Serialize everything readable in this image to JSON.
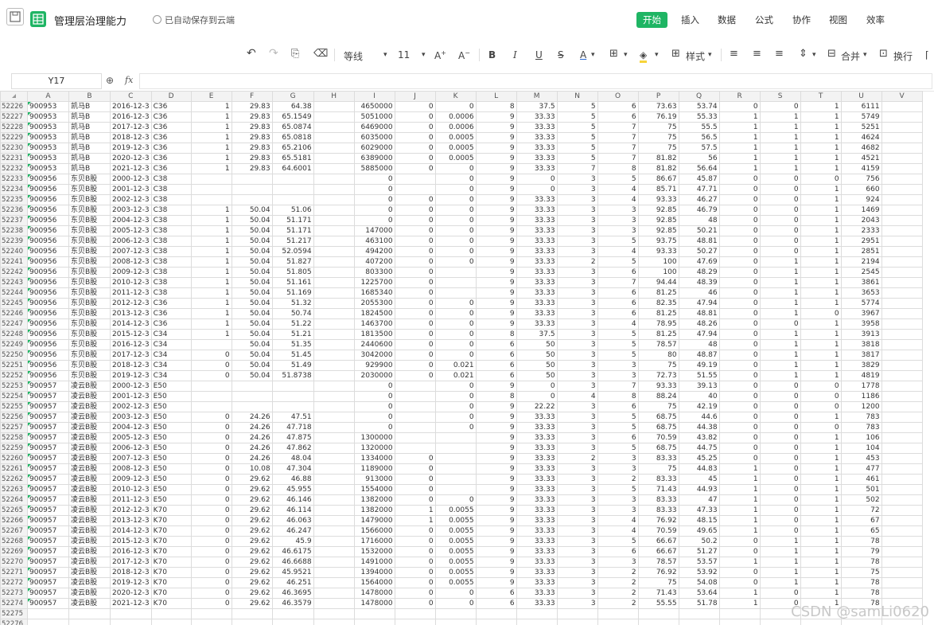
{
  "titlebar": {
    "doc_title": "管理层治理能力",
    "autosave": "已自动保存到云端",
    "menus": [
      "开始",
      "插入",
      "数据",
      "公式",
      "协作",
      "视图",
      "效率"
    ],
    "active_menu": "开始"
  },
  "toolbar": {
    "font_name": "等线",
    "font_size": "11",
    "style_label": "样式",
    "merge_label": "合并",
    "wrap_label": "换行"
  },
  "formulabar": {
    "cell_ref": "Y17",
    "fx": "fx",
    "value": ""
  },
  "columns": [
    "A",
    "B",
    "C",
    "D",
    "E",
    "F",
    "G",
    "H",
    "I",
    "J",
    "K",
    "L",
    "M",
    "N",
    "O",
    "P",
    "Q",
    "R",
    "S",
    "T",
    "U",
    "V"
  ],
  "rows": [
    {
      "n": "52226",
      "c": [
        "900953",
        "凯马B",
        "2016-12-3",
        "C36",
        "1",
        "29.83",
        "64.38",
        "",
        "4650000",
        "0",
        "0",
        "8",
        "37.5",
        "5",
        "6",
        "73.63",
        "53.74",
        "0",
        "0",
        "1",
        "6111"
      ]
    },
    {
      "n": "52227",
      "c": [
        "900953",
        "凯马B",
        "2016-12-3",
        "C36",
        "1",
        "29.83",
        "65.1549",
        "",
        "5051000",
        "0",
        "0.0006",
        "9",
        "33.33",
        "5",
        "6",
        "76.19",
        "55.33",
        "1",
        "1",
        "1",
        "5749"
      ]
    },
    {
      "n": "52228",
      "c": [
        "900953",
        "凯马B",
        "2017-12-3",
        "C36",
        "1",
        "29.83",
        "65.0874",
        "",
        "6469000",
        "0",
        "0.0006",
        "9",
        "33.33",
        "5",
        "7",
        "75",
        "55.5",
        "1",
        "1",
        "1",
        "5251"
      ]
    },
    {
      "n": "52229",
      "c": [
        "900953",
        "凯马B",
        "2018-12-3",
        "C36",
        "1",
        "29.83",
        "65.0818",
        "",
        "6035000",
        "0",
        "0.0005",
        "9",
        "33.33",
        "5",
        "7",
        "75",
        "56.5",
        "1",
        "1",
        "1",
        "4624"
      ]
    },
    {
      "n": "52230",
      "c": [
        "900953",
        "凯马B",
        "2019-12-3",
        "C36",
        "1",
        "29.83",
        "65.2106",
        "",
        "6029000",
        "0",
        "0.0005",
        "9",
        "33.33",
        "5",
        "7",
        "75",
        "57.5",
        "1",
        "1",
        "1",
        "4682"
      ]
    },
    {
      "n": "52231",
      "c": [
        "900953",
        "凯马B",
        "2020-12-3",
        "C36",
        "1",
        "29.83",
        "65.5181",
        "",
        "6389000",
        "0",
        "0.0005",
        "9",
        "33.33",
        "5",
        "7",
        "81.82",
        "56",
        "1",
        "1",
        "1",
        "4521"
      ]
    },
    {
      "n": "52232",
      "c": [
        "900953",
        "凯马B",
        "2021-12-3",
        "C36",
        "1",
        "29.83",
        "64.6001",
        "",
        "5885000",
        "0",
        "0",
        "9",
        "33.33",
        "7",
        "8",
        "81.82",
        "56.64",
        "1",
        "1",
        "1",
        "4159"
      ]
    },
    {
      "n": "52233",
      "c": [
        "900956",
        "东贝B股",
        "2000-12-3",
        "C38",
        "",
        "",
        "",
        "",
        "0",
        "",
        "0",
        "9",
        "0",
        "3",
        "5",
        "86.67",
        "45.87",
        "0",
        "0",
        "0",
        "756"
      ]
    },
    {
      "n": "52234",
      "c": [
        "900956",
        "东贝B股",
        "2001-12-3",
        "C38",
        "",
        "",
        "",
        "",
        "0",
        "",
        "0",
        "9",
        "0",
        "3",
        "4",
        "85.71",
        "47.71",
        "0",
        "0",
        "1",
        "660"
      ]
    },
    {
      "n": "52235",
      "c": [
        "900956",
        "东贝B股",
        "2002-12-3",
        "C38",
        "",
        "",
        "",
        "",
        "0",
        "0",
        "0",
        "9",
        "33.33",
        "3",
        "4",
        "93.33",
        "46.27",
        "0",
        "0",
        "1",
        "924"
      ]
    },
    {
      "n": "52236",
      "c": [
        "900956",
        "东贝B股",
        "2003-12-3",
        "C38",
        "1",
        "50.04",
        "51.06",
        "",
        "0",
        "0",
        "0",
        "9",
        "33.33",
        "3",
        "3",
        "92.85",
        "46.79",
        "0",
        "0",
        "1",
        "1469"
      ]
    },
    {
      "n": "52237",
      "c": [
        "900956",
        "东贝B股",
        "2004-12-3",
        "C38",
        "1",
        "50.04",
        "51.171",
        "",
        "0",
        "0",
        "0",
        "9",
        "33.33",
        "3",
        "3",
        "92.85",
        "48",
        "0",
        "0",
        "1",
        "2043"
      ]
    },
    {
      "n": "52238",
      "c": [
        "900956",
        "东贝B股",
        "2005-12-3",
        "C38",
        "1",
        "50.04",
        "51.171",
        "",
        "147000",
        "0",
        "0",
        "9",
        "33.33",
        "3",
        "3",
        "92.85",
        "50.21",
        "0",
        "0",
        "1",
        "2333"
      ]
    },
    {
      "n": "52239",
      "c": [
        "900956",
        "东贝B股",
        "2006-12-3",
        "C38",
        "1",
        "50.04",
        "51.217",
        "",
        "463100",
        "0",
        "0",
        "9",
        "33.33",
        "3",
        "5",
        "93.75",
        "48.81",
        "0",
        "0",
        "1",
        "2951"
      ]
    },
    {
      "n": "52240",
      "c": [
        "900956",
        "东贝B股",
        "2007-12-3",
        "C38",
        "1",
        "50.04",
        "52.0594",
        "",
        "494200",
        "0",
        "0",
        "9",
        "33.33",
        "3",
        "4",
        "93.33",
        "50.27",
        "0",
        "0",
        "1",
        "2851"
      ]
    },
    {
      "n": "52241",
      "c": [
        "900956",
        "东贝B股",
        "2008-12-3",
        "C38",
        "1",
        "50.04",
        "51.827",
        "",
        "407200",
        "0",
        "0",
        "9",
        "33.33",
        "2",
        "5",
        "100",
        "47.69",
        "0",
        "1",
        "1",
        "2194"
      ]
    },
    {
      "n": "52242",
      "c": [
        "900956",
        "东贝B股",
        "2009-12-3",
        "C38",
        "1",
        "50.04",
        "51.805",
        "",
        "803300",
        "0",
        "",
        "9",
        "33.33",
        "3",
        "6",
        "100",
        "48.29",
        "0",
        "1",
        "1",
        "2545"
      ]
    },
    {
      "n": "52243",
      "c": [
        "900956",
        "东贝B股",
        "2010-12-3",
        "C38",
        "1",
        "50.04",
        "51.161",
        "",
        "1225700",
        "0",
        "",
        "9",
        "33.33",
        "3",
        "7",
        "94.44",
        "48.39",
        "0",
        "1",
        "1",
        "3861"
      ]
    },
    {
      "n": "52244",
      "c": [
        "900956",
        "东贝B股",
        "2011-12-3",
        "C38",
        "1",
        "50.04",
        "51.169",
        "",
        "1685340",
        "0",
        "",
        "9",
        "33.33",
        "3",
        "6",
        "81.25",
        "46",
        "0",
        "1",
        "1",
        "3653"
      ]
    },
    {
      "n": "52245",
      "c": [
        "900956",
        "东贝B股",
        "2012-12-3",
        "C36",
        "1",
        "50.04",
        "51.32",
        "",
        "2055300",
        "0",
        "0",
        "9",
        "33.33",
        "3",
        "6",
        "82.35",
        "47.94",
        "0",
        "1",
        "1",
        "5774"
      ]
    },
    {
      "n": "52246",
      "c": [
        "900956",
        "东贝B股",
        "2013-12-3",
        "C36",
        "1",
        "50.04",
        "50.74",
        "",
        "1824500",
        "0",
        "0",
        "9",
        "33.33",
        "3",
        "6",
        "81.25",
        "48.81",
        "0",
        "1",
        "0",
        "3967"
      ]
    },
    {
      "n": "52247",
      "c": [
        "900956",
        "东贝B股",
        "2014-12-3",
        "C36",
        "1",
        "50.04",
        "51.22",
        "",
        "1463700",
        "0",
        "0",
        "9",
        "33.33",
        "3",
        "4",
        "78.95",
        "48.26",
        "0",
        "0",
        "1",
        "3958"
      ]
    },
    {
      "n": "52248",
      "c": [
        "900956",
        "东贝B股",
        "2015-12-3",
        "C34",
        "1",
        "50.04",
        "51.21",
        "",
        "1813500",
        "0",
        "0",
        "8",
        "37.5",
        "3",
        "5",
        "81.25",
        "47.94",
        "0",
        "1",
        "1",
        "3913"
      ]
    },
    {
      "n": "52249",
      "c": [
        "900956",
        "东贝B股",
        "2016-12-3",
        "C34",
        "",
        "50.04",
        "51.35",
        "",
        "2440600",
        "0",
        "0",
        "6",
        "50",
        "3",
        "5",
        "78.57",
        "48",
        "0",
        "1",
        "1",
        "3818"
      ]
    },
    {
      "n": "52250",
      "c": [
        "900956",
        "东贝B股",
        "2017-12-3",
        "C34",
        "0",
        "50.04",
        "51.45",
        "",
        "3042000",
        "0",
        "0",
        "6",
        "50",
        "3",
        "5",
        "80",
        "48.87",
        "0",
        "1",
        "1",
        "3817"
      ]
    },
    {
      "n": "52251",
      "c": [
        "900956",
        "东贝B股",
        "2018-12-3",
        "C34",
        "0",
        "50.04",
        "51.49",
        "",
        "929900",
        "0",
        "0.021",
        "6",
        "50",
        "3",
        "3",
        "75",
        "49.19",
        "0",
        "1",
        "1",
        "3829"
      ]
    },
    {
      "n": "52252",
      "c": [
        "900956",
        "东贝B股",
        "2019-12-3",
        "C34",
        "0",
        "50.04",
        "51.8738",
        "",
        "2030000",
        "0",
        "0.021",
        "6",
        "50",
        "3",
        "3",
        "72.73",
        "51.55",
        "0",
        "1",
        "1",
        "4819"
      ]
    },
    {
      "n": "52253",
      "c": [
        "900957",
        "凌云B股",
        "2000-12-3",
        "E50",
        "",
        "",
        "",
        "",
        "0",
        "",
        "0",
        "9",
        "0",
        "3",
        "7",
        "93.33",
        "39.13",
        "0",
        "0",
        "0",
        "1778"
      ]
    },
    {
      "n": "52254",
      "c": [
        "900957",
        "凌云B股",
        "2001-12-3",
        "E50",
        "",
        "",
        "",
        "",
        "0",
        "",
        "0",
        "8",
        "0",
        "4",
        "8",
        "88.24",
        "40",
        "0",
        "0",
        "0",
        "1186"
      ]
    },
    {
      "n": "52255",
      "c": [
        "900957",
        "凌云B股",
        "2002-12-3",
        "E50",
        "",
        "",
        "",
        "",
        "0",
        "",
        "0",
        "9",
        "22.22",
        "3",
        "6",
        "75",
        "42.19",
        "0",
        "0",
        "0",
        "1200"
      ]
    },
    {
      "n": "52256",
      "c": [
        "900957",
        "凌云B股",
        "2003-12-3",
        "E50",
        "0",
        "24.26",
        "47.51",
        "",
        "0",
        "",
        "0",
        "9",
        "33.33",
        "3",
        "5",
        "68.75",
        "44.6",
        "0",
        "0",
        "1",
        "783"
      ]
    },
    {
      "n": "52257",
      "c": [
        "900957",
        "凌云B股",
        "2004-12-3",
        "E50",
        "0",
        "24.26",
        "47.718",
        "",
        "0",
        "",
        "0",
        "9",
        "33.33",
        "3",
        "5",
        "68.75",
        "44.38",
        "0",
        "0",
        "0",
        "783"
      ]
    },
    {
      "n": "52258",
      "c": [
        "900957",
        "凌云B股",
        "2005-12-3",
        "E50",
        "0",
        "24.26",
        "47.875",
        "",
        "1300000",
        "",
        "",
        "9",
        "33.33",
        "3",
        "6",
        "70.59",
        "43.82",
        "0",
        "0",
        "1",
        "106"
      ]
    },
    {
      "n": "52259",
      "c": [
        "900957",
        "凌云B股",
        "2006-12-3",
        "E50",
        "0",
        "24.26",
        "47.862",
        "",
        "1320000",
        "",
        "",
        "9",
        "33.33",
        "3",
        "5",
        "68.75",
        "44.75",
        "0",
        "0",
        "1",
        "104"
      ]
    },
    {
      "n": "52260",
      "c": [
        "900957",
        "凌云B股",
        "2007-12-3",
        "E50",
        "0",
        "24.26",
        "48.04",
        "",
        "1334000",
        "0",
        "",
        "9",
        "33.33",
        "2",
        "3",
        "83.33",
        "45.25",
        "0",
        "0",
        "1",
        "453"
      ]
    },
    {
      "n": "52261",
      "c": [
        "900957",
        "凌云B股",
        "2008-12-3",
        "E50",
        "0",
        "10.08",
        "47.304",
        "",
        "1189000",
        "0",
        "",
        "9",
        "33.33",
        "3",
        "3",
        "75",
        "44.83",
        "1",
        "0",
        "1",
        "477"
      ]
    },
    {
      "n": "52262",
      "c": [
        "900957",
        "凌云B股",
        "2009-12-3",
        "E50",
        "0",
        "29.62",
        "46.88",
        "",
        "913000",
        "0",
        "",
        "9",
        "33.33",
        "3",
        "2",
        "83.33",
        "45",
        "1",
        "0",
        "1",
        "461"
      ]
    },
    {
      "n": "52263",
      "c": [
        "900957",
        "凌云B股",
        "2010-12-3",
        "E50",
        "0",
        "29.62",
        "45.955",
        "",
        "1554000",
        "0",
        "",
        "9",
        "33.33",
        "3",
        "5",
        "71.43",
        "44.93",
        "1",
        "0",
        "1",
        "501"
      ]
    },
    {
      "n": "52264",
      "c": [
        "900957",
        "凌云B股",
        "2011-12-3",
        "E50",
        "0",
        "29.62",
        "46.146",
        "",
        "1382000",
        "0",
        "0",
        "9",
        "33.33",
        "3",
        "3",
        "83.33",
        "47",
        "1",
        "0",
        "1",
        "502"
      ]
    },
    {
      "n": "52265",
      "c": [
        "900957",
        "凌云B股",
        "2012-12-3",
        "K70",
        "0",
        "29.62",
        "46.114",
        "",
        "1382000",
        "1",
        "0.0055",
        "9",
        "33.33",
        "3",
        "3",
        "83.33",
        "47.33",
        "1",
        "0",
        "1",
        "72"
      ]
    },
    {
      "n": "52266",
      "c": [
        "900957",
        "凌云B股",
        "2013-12-3",
        "K70",
        "0",
        "29.62",
        "46.063",
        "",
        "1479000",
        "1",
        "0.0055",
        "9",
        "33.33",
        "3",
        "4",
        "76.92",
        "48.15",
        "1",
        "0",
        "1",
        "67"
      ]
    },
    {
      "n": "52267",
      "c": [
        "900957",
        "凌云B股",
        "2014-12-3",
        "K70",
        "0",
        "29.62",
        "46.247",
        "",
        "1566000",
        "0",
        "0.0055",
        "9",
        "33.33",
        "3",
        "4",
        "70.59",
        "49.65",
        "1",
        "0",
        "1",
        "65"
      ]
    },
    {
      "n": "52268",
      "c": [
        "900957",
        "凌云B股",
        "2015-12-3",
        "K70",
        "0",
        "29.62",
        "45.9",
        "",
        "1716000",
        "0",
        "0.0055",
        "9",
        "33.33",
        "3",
        "5",
        "66.67",
        "50.2",
        "0",
        "1",
        "1",
        "78"
      ]
    },
    {
      "n": "52269",
      "c": [
        "900957",
        "凌云B股",
        "2016-12-3",
        "K70",
        "0",
        "29.62",
        "46.6175",
        "",
        "1532000",
        "0",
        "0.0055",
        "9",
        "33.33",
        "3",
        "6",
        "66.67",
        "51.27",
        "0",
        "1",
        "1",
        "79"
      ]
    },
    {
      "n": "52270",
      "c": [
        "900957",
        "凌云B股",
        "2017-12-3",
        "K70",
        "0",
        "29.62",
        "46.6688",
        "",
        "1491000",
        "0",
        "0.0055",
        "9",
        "33.33",
        "3",
        "3",
        "78.57",
        "53.57",
        "1",
        "1",
        "1",
        "78"
      ]
    },
    {
      "n": "52271",
      "c": [
        "900957",
        "凌云B股",
        "2018-12-3",
        "K70",
        "0",
        "29.62",
        "45.9521",
        "",
        "1394000",
        "0",
        "0.0055",
        "9",
        "33.33",
        "3",
        "2",
        "76.92",
        "53.92",
        "0",
        "1",
        "1",
        "75"
      ]
    },
    {
      "n": "52272",
      "c": [
        "900957",
        "凌云B股",
        "2019-12-3",
        "K70",
        "0",
        "29.62",
        "46.251",
        "",
        "1564000",
        "0",
        "0.0055",
        "9",
        "33.33",
        "3",
        "2",
        "75",
        "54.08",
        "0",
        "1",
        "1",
        "78"
      ]
    },
    {
      "n": "52273",
      "c": [
        "900957",
        "凌云B股",
        "2020-12-3",
        "K70",
        "0",
        "29.62",
        "46.3695",
        "",
        "1478000",
        "0",
        "0",
        "6",
        "33.33",
        "3",
        "2",
        "71.43",
        "53.64",
        "1",
        "0",
        "1",
        "78"
      ]
    },
    {
      "n": "52274",
      "c": [
        "900957",
        "凌云B股",
        "2021-12-3",
        "K70",
        "0",
        "29.62",
        "46.3579",
        "",
        "1478000",
        "0",
        "0",
        "6",
        "33.33",
        "3",
        "2",
        "55.55",
        "51.78",
        "1",
        "0",
        "1",
        "78"
      ]
    },
    {
      "n": "52275",
      "c": [
        "",
        "",
        "",
        "",
        "",
        "",
        "",
        "",
        "",
        "",
        "",
        "",
        "",
        "",
        "",
        "",
        "",
        "",
        "",
        "",
        ""
      ]
    },
    {
      "n": "52276",
      "c": [
        "",
        "",
        "",
        "",
        "",
        "",
        "",
        "",
        "",
        "",
        "",
        "",
        "",
        "",
        "",
        "",
        "",
        "",
        "",
        "",
        ""
      ]
    }
  ],
  "watermark": "CSDN @samLi0620"
}
